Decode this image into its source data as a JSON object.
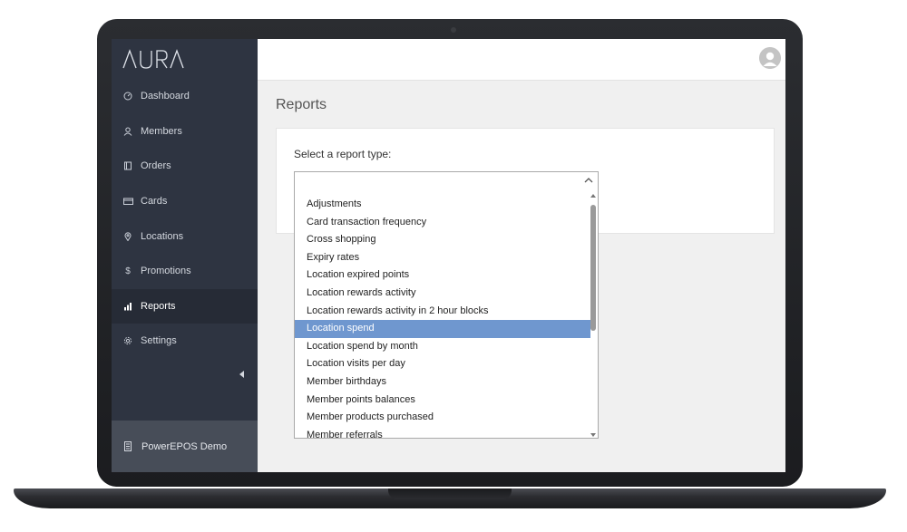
{
  "app": {
    "logo_text": "AURA"
  },
  "sidebar": {
    "items": [
      {
        "label": "Dashboard",
        "icon": "dashboard-icon",
        "active": false
      },
      {
        "label": "Members",
        "icon": "user-icon",
        "active": false
      },
      {
        "label": "Orders",
        "icon": "orders-icon",
        "active": false
      },
      {
        "label": "Cards",
        "icon": "card-icon",
        "active": false
      },
      {
        "label": "Locations",
        "icon": "location-pin-icon",
        "active": false
      },
      {
        "label": "Promotions",
        "icon": "dollar-icon",
        "active": false
      },
      {
        "label": "Reports",
        "icon": "bar-chart-icon",
        "active": true
      },
      {
        "label": "Settings",
        "icon": "gear-icon",
        "active": false
      }
    ],
    "account_label": "PowerEPOS Demo"
  },
  "main": {
    "page_title": "Reports",
    "select_label": "Select a report type:",
    "report_options": [
      "Adjustments",
      "Card transaction frequency",
      "Cross shopping",
      "Expiry rates",
      "Location expired points",
      "Location rewards activity",
      "Location rewards activity in 2 hour blocks",
      "Location spend",
      "Location spend by month",
      "Location visits per day",
      "Member birthdays",
      "Member points balances",
      "Member products purchased",
      "Member referrals"
    ],
    "selected_option": "Location spend"
  },
  "colors": {
    "sidebar_bg": "#2e3441",
    "sidebar_active_bg": "#262b36",
    "account_bg": "#474d58",
    "selection_highlight": "#6f97cf"
  }
}
